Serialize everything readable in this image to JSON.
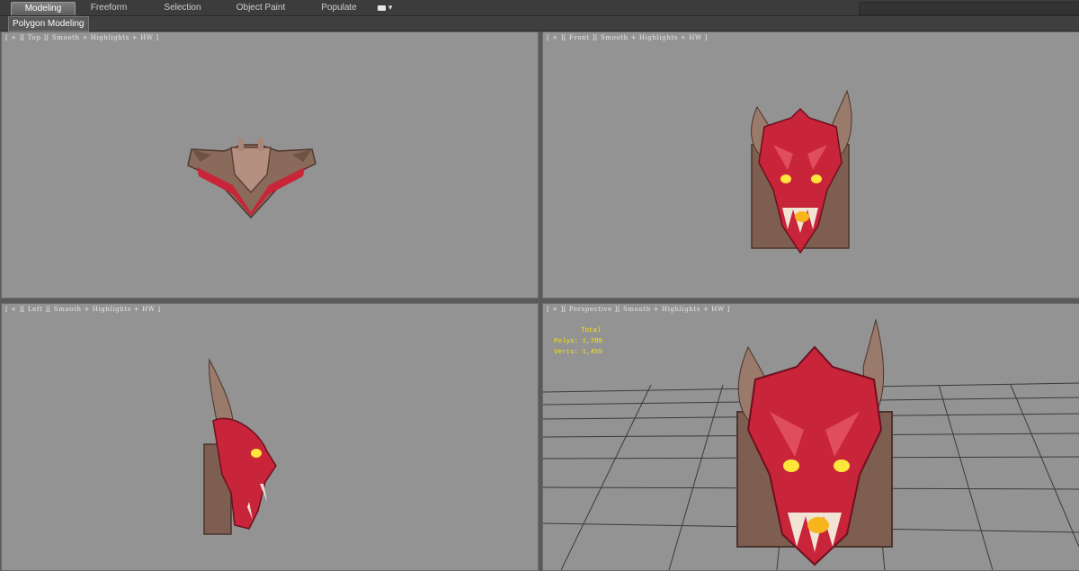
{
  "ribbon": {
    "tabs": [
      {
        "label": "Modeling",
        "active": true
      },
      {
        "label": "Freeform",
        "active": false
      },
      {
        "label": "Selection",
        "active": false
      },
      {
        "label": "Object Paint",
        "active": false
      },
      {
        "label": "Populate",
        "active": false
      }
    ],
    "panel_label": "Polygon Modeling"
  },
  "viewports": {
    "top": {
      "label": "[ + ][ Top ][ Smooth + Highlights + HW ]"
    },
    "front": {
      "label": "[ + ][ Front ][ Smooth + Highlights + HW ]"
    },
    "left": {
      "label": "[ + ][ Left ][ Smooth + Highlights + HW ]"
    },
    "perspective": {
      "label": "[ + ][ Perspective ][ Smooth + Highlights + HW ]",
      "stats": {
        "header": "Total",
        "polys_label": "Polys:",
        "polys_value": "1,789",
        "verts_label": "Verts:",
        "verts_value": "1,455"
      }
    }
  },
  "colors": {
    "viewport_bg": "#939393",
    "stats_text": "#ffe600",
    "stone": "#8a6a5a",
    "red": "#c8243a"
  }
}
